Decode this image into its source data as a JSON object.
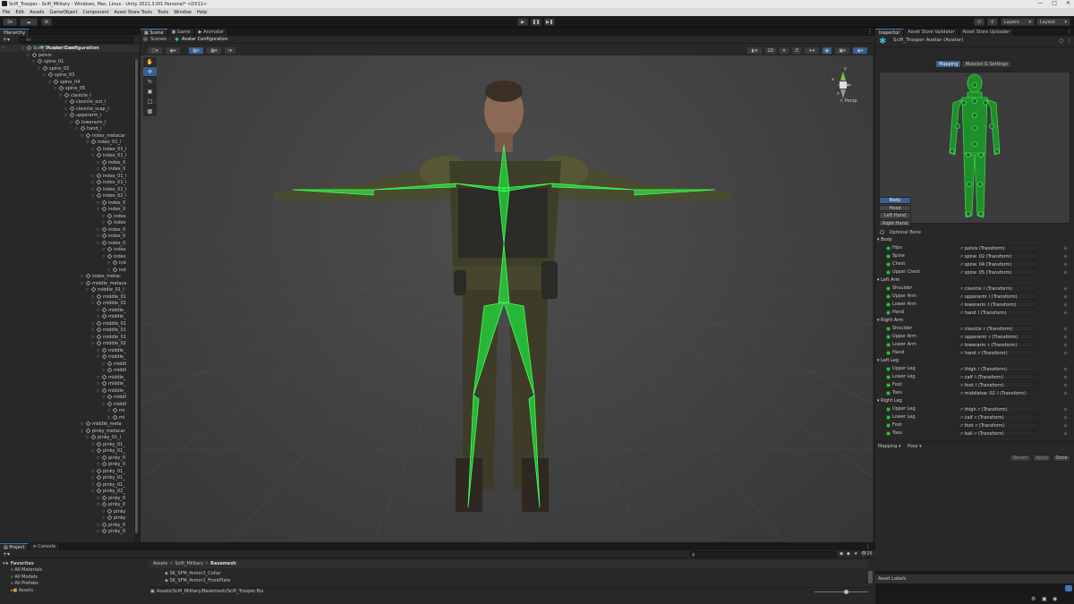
{
  "window": {
    "title": "Scifi_Trooper - Scifi_Military - Windows, Mac, Linux - Unity 2021.3.0f1 Personal* <DX11>"
  },
  "menu": [
    "File",
    "Edit",
    "Assets",
    "GameObject",
    "Component",
    "Asset Store Tools",
    "Tools",
    "Window",
    "Help"
  ],
  "toolbar": {
    "account": "S",
    "layers": "Layers",
    "layout": "Layout"
  },
  "hierarchy": {
    "tab": "Hierarchy",
    "search_placeholder": "All",
    "scene_name": "Avatar Configuration",
    "items": [
      {
        "label": "Scifi_Trooper(Clone)",
        "depth": 0
      },
      {
        "label": "pelvis",
        "depth": 1
      },
      {
        "label": "spine_01",
        "depth": 2
      },
      {
        "label": "spine_02",
        "depth": 3
      },
      {
        "label": "spine_03",
        "depth": 4
      },
      {
        "label": "spine_04",
        "depth": 5
      },
      {
        "label": "spine_05",
        "depth": 6
      },
      {
        "label": "clavicle_l",
        "depth": 7
      },
      {
        "label": "clavicle_out_l",
        "depth": 8
      },
      {
        "label": "clavicle_scap_l",
        "depth": 8
      },
      {
        "label": "upperarm_l",
        "depth": 8
      },
      {
        "label": "lowerarm_l",
        "depth": 9
      },
      {
        "label": "hand_l",
        "depth": 10
      },
      {
        "label": "index_metacar",
        "depth": 11
      },
      {
        "label": "index_01_l",
        "depth": 12
      },
      {
        "label": "index_01_l",
        "depth": 13
      },
      {
        "label": "index_01_l",
        "depth": 13
      },
      {
        "label": "index_0",
        "depth": 14
      },
      {
        "label": "index_0",
        "depth": 14
      },
      {
        "label": "index_01_l",
        "depth": 13
      },
      {
        "label": "index_01_l",
        "depth": 13
      },
      {
        "label": "index_01_l",
        "depth": 13
      },
      {
        "label": "index_02_l",
        "depth": 13
      },
      {
        "label": "index_0",
        "depth": 14
      },
      {
        "label": "index_0",
        "depth": 14
      },
      {
        "label": "index",
        "depth": 15
      },
      {
        "label": "index",
        "depth": 15
      },
      {
        "label": "index_0",
        "depth": 14
      },
      {
        "label": "index_0",
        "depth": 14
      },
      {
        "label": "index_0",
        "depth": 14
      },
      {
        "label": "index",
        "depth": 15
      },
      {
        "label": "index",
        "depth": 15
      },
      {
        "label": "ind",
        "depth": 16
      },
      {
        "label": "ind",
        "depth": 16
      },
      {
        "label": "index_metac",
        "depth": 11
      },
      {
        "label": "middle_metaca",
        "depth": 11
      },
      {
        "label": "middle_01_l",
        "depth": 12
      },
      {
        "label": "middle_01",
        "depth": 13
      },
      {
        "label": "middle_01",
        "depth": 13
      },
      {
        "label": "middle_",
        "depth": 14
      },
      {
        "label": "middle_",
        "depth": 14
      },
      {
        "label": "middle_01",
        "depth": 13
      },
      {
        "label": "middle_01",
        "depth": 13
      },
      {
        "label": "middle_01",
        "depth": 13
      },
      {
        "label": "middle_02",
        "depth": 13
      },
      {
        "label": "middle_",
        "depth": 14
      },
      {
        "label": "middle_",
        "depth": 14
      },
      {
        "label": "middl",
        "depth": 15
      },
      {
        "label": "middl",
        "depth": 15
      },
      {
        "label": "middle_",
        "depth": 14
      },
      {
        "label": "middle_",
        "depth": 14
      },
      {
        "label": "middle_",
        "depth": 14
      },
      {
        "label": "middl",
        "depth": 15
      },
      {
        "label": "middl",
        "depth": 15
      },
      {
        "label": "mi",
        "depth": 16
      },
      {
        "label": "mi",
        "depth": 16
      },
      {
        "label": "middle_meta",
        "depth": 11
      },
      {
        "label": "pinky_metacar",
        "depth": 11
      },
      {
        "label": "pinky_01_l",
        "depth": 12
      },
      {
        "label": "pinky_01_",
        "depth": 13
      },
      {
        "label": "pinky_01_",
        "depth": 13
      },
      {
        "label": "pinky_0",
        "depth": 14
      },
      {
        "label": "pinky_0",
        "depth": 14
      },
      {
        "label": "pinky_01_",
        "depth": 13
      },
      {
        "label": "pinky_01_",
        "depth": 13
      },
      {
        "label": "pinky_01_",
        "depth": 13
      },
      {
        "label": "pinky_02_",
        "depth": 13
      },
      {
        "label": "pinky_0",
        "depth": 14
      },
      {
        "label": "pinky_0",
        "depth": 14
      },
      {
        "label": "pinky",
        "depth": 15
      },
      {
        "label": "pinky",
        "depth": 15
      },
      {
        "label": "pinky_0",
        "depth": 14
      },
      {
        "label": "pinky_0",
        "depth": 14
      }
    ]
  },
  "scene": {
    "tabs": [
      "Scene",
      "Game",
      "Animator"
    ],
    "breadcrumb_root": "Scenes",
    "breadcrumb_current": "Avatar Configuration",
    "mode_2d": "2D",
    "persp_label": "< Persp",
    "axis_labels": {
      "y": "y",
      "x": "x",
      "z": "z"
    }
  },
  "inspector": {
    "tabs": [
      "Inspector",
      "Asset Store Validator",
      "Asset Store Uploader"
    ],
    "object_name": "Scifi_Trooper Avatar (Avatar)",
    "mode_tabs": [
      "Mapping",
      "Muscles & Settings"
    ],
    "body_buttons": [
      "Body",
      "Head",
      "Left Hand",
      "Right Hand"
    ],
    "optional_bone": "Optional Bone",
    "groups": [
      {
        "name": "Body",
        "rows": [
          {
            "label": "Hips",
            "value": "pelvis (Transform)"
          },
          {
            "label": "Spine",
            "value": "spine_02 (Transform)"
          },
          {
            "label": "Chest",
            "value": "spine_04 (Transform)"
          },
          {
            "label": "Upper Chest",
            "value": "spine_05 (Transform)"
          }
        ]
      },
      {
        "name": "Left Arm",
        "rows": [
          {
            "label": "Shoulder",
            "value": "clavicle_l (Transform)"
          },
          {
            "label": "Upper Arm",
            "value": "upperarm_l (Transform)"
          },
          {
            "label": "Lower Arm",
            "value": "lowerarm_l (Transform)"
          },
          {
            "label": "Hand",
            "value": "hand_l (Transform)"
          }
        ]
      },
      {
        "name": "Right Arm",
        "rows": [
          {
            "label": "Shoulder",
            "value": "clavicle_r (Transform)"
          },
          {
            "label": "Upper Arm",
            "value": "upperarm_r (Transform)"
          },
          {
            "label": "Lower Arm",
            "value": "lowerarm_r (Transform)"
          },
          {
            "label": "Hand",
            "value": "hand_r (Transform)"
          }
        ]
      },
      {
        "name": "Left Leg",
        "rows": [
          {
            "label": "Upper Leg",
            "value": "thigh_l (Transform)"
          },
          {
            "label": "Lower Leg",
            "value": "calf_l (Transform)"
          },
          {
            "label": "Foot",
            "value": "foot_l (Transform)"
          },
          {
            "label": "Toes",
            "value": "middletoe_02_l (Transform)"
          }
        ]
      },
      {
        "name": "Right Leg",
        "rows": [
          {
            "label": "Upper Leg",
            "value": "thigh_r (Transform)"
          },
          {
            "label": "Lower Leg",
            "value": "calf_r (Transform)"
          },
          {
            "label": "Foot",
            "value": "foot_r (Transform)"
          },
          {
            "label": "Toes",
            "value": "ball_r (Transform)"
          }
        ]
      }
    ],
    "mapping_dropdown": "Mapping",
    "pose_dropdown": "Pose",
    "revert": "Revert",
    "apply": "Apply",
    "done": "Done",
    "asset_labels": "Asset Labels"
  },
  "project": {
    "tabs": [
      "Project",
      "Console"
    ],
    "favorites": "Favorites",
    "favorite_items": [
      "All Materials",
      "All Models",
      "All Prefabs"
    ],
    "assets_root": "Assets",
    "breadcrumb": [
      "Assets",
      "Scifi_Military",
      "Basemesh"
    ],
    "files": [
      "SK_SFM_Armor1_Collar",
      "SK_SFM_Armor1_FrontPlate"
    ],
    "path": "Assets/Scifi_Military/Basemesh/Scifi_Trooper.fbx",
    "count": "26"
  },
  "colors": {
    "bone_green": "#22e03c",
    "accent_blue": "#3a79bb",
    "panel": "#282828"
  }
}
